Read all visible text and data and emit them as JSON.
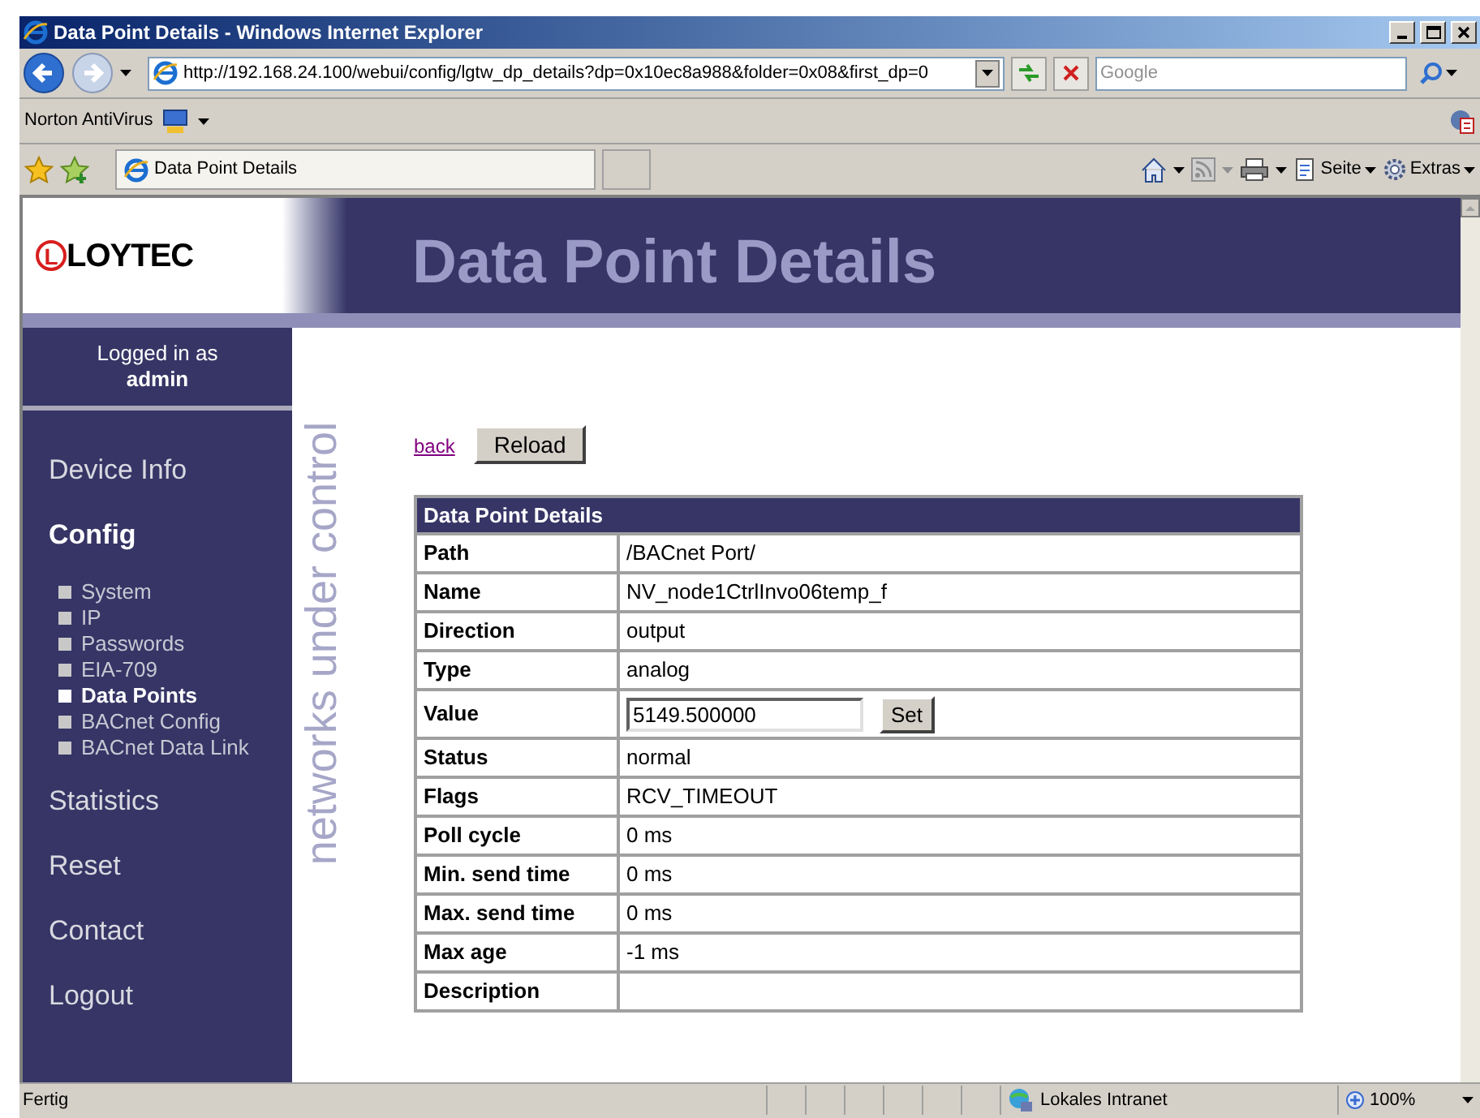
{
  "window": {
    "title": "Data Point Details - Windows Internet Explorer"
  },
  "address_bar": {
    "url": "http://192.168.24.100/webui/config/lgtw_dp_details?dp=0x10ec8a988&folder=0x08&first_dp=0",
    "search_placeholder": "Google"
  },
  "links_bar": {
    "label": "Norton AntiVirus"
  },
  "tab_bar": {
    "tab": "Data Point Details",
    "commands": [
      "Seite",
      "Extras"
    ]
  },
  "page": {
    "logo_mark": "L",
    "logo": "LOYTEC",
    "title": "Data Point Details",
    "login": {
      "label": "Logged in as",
      "user": "admin"
    },
    "nav": [
      {
        "label": "Device Info",
        "selected": false
      },
      {
        "label": "Config",
        "selected": true,
        "children": [
          {
            "label": "System",
            "selected": false
          },
          {
            "label": "IP",
            "selected": false
          },
          {
            "label": "Passwords",
            "selected": false
          },
          {
            "label": "EIA-709",
            "selected": false
          },
          {
            "label": "Data Points",
            "selected": true
          },
          {
            "label": "BACnet Config",
            "selected": false
          },
          {
            "label": "BACnet Data Link",
            "selected": false
          }
        ]
      },
      {
        "label": "Statistics",
        "selected": false
      },
      {
        "label": "Reset",
        "selected": false
      },
      {
        "label": "Contact",
        "selected": false
      },
      {
        "label": "Logout",
        "selected": false
      }
    ],
    "slogan": "networks under control",
    "back_link": "back",
    "reload_button": "Reload",
    "table": {
      "title": "Data Point Details",
      "rows": [
        {
          "kind": "text",
          "label": "Path",
          "value": "/BACnet Port/"
        },
        {
          "kind": "text",
          "label": "Name",
          "value": "NV_node1CtrlInvo06temp_f"
        },
        {
          "kind": "text",
          "label": "Direction",
          "value": "output"
        },
        {
          "kind": "text",
          "label": "Type",
          "value": "analog"
        },
        {
          "kind": "input",
          "label": "Value",
          "value": "5149.500000",
          "button": "Set"
        },
        {
          "kind": "text",
          "label": "Status",
          "value": "normal"
        },
        {
          "kind": "text",
          "label": "Flags",
          "value": "RCV_TIMEOUT"
        },
        {
          "kind": "text",
          "label": "Poll cycle",
          "value": "0 ms"
        },
        {
          "kind": "text",
          "label": "Min. send time",
          "value": "0 ms"
        },
        {
          "kind": "text",
          "label": "Max. send time",
          "value": "0 ms"
        },
        {
          "kind": "text",
          "label": "Max age",
          "value": "-1 ms"
        },
        {
          "kind": "text",
          "label": "Description",
          "value": ""
        }
      ]
    }
  },
  "status_bar": {
    "text": "Fertig",
    "zone": "Lokales Intranet",
    "zoom": "100%"
  }
}
